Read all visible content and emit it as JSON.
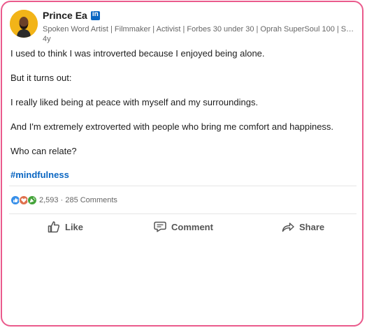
{
  "author": {
    "name": "Prince Ea",
    "headline": "Spoken Word Artist | Filmmaker | Activist | Forbes 30 under 30 | Oprah SuperSoul 100 | Success Maga...",
    "time": "4y",
    "badge": "in"
  },
  "post": {
    "paragraphs": [
      "I used to think I was introverted because I enjoyed being alone.",
      "But it turns out:",
      "I really liked being at peace with myself and my surroundings.",
      "And I'm extremely extroverted with people who bring me comfort and happiness.",
      "Who can relate?"
    ],
    "hashtag": "#mindfulness"
  },
  "social": {
    "reaction_icons": [
      "like-icon",
      "love-icon",
      "celebrate-icon"
    ],
    "reactions_count": "2,593",
    "separator": "·",
    "comments": "285 Comments"
  },
  "actions": {
    "like": "Like",
    "comment": "Comment",
    "share": "Share"
  },
  "colors": {
    "frame": "#ea5a8c",
    "link": "#0a66c2",
    "avatar_bg": "#f2b418"
  }
}
